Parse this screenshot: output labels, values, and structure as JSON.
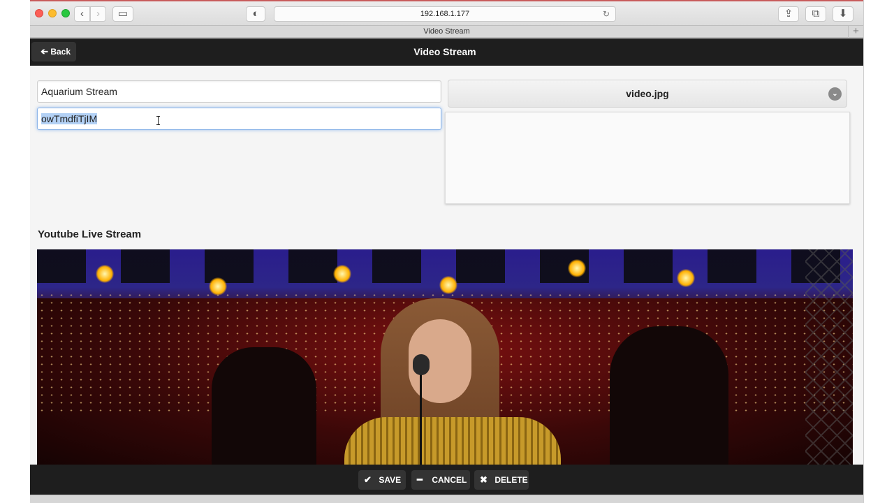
{
  "browser": {
    "url": "192.168.1.177",
    "tab_title": "Video Stream",
    "back_icon": "‹",
    "forward_icon": "›",
    "sidebar_icon": "▭",
    "privacy_icon": "◐",
    "reload_icon": "↻",
    "share_icon": "⇪",
    "tabs_icon": "⧉",
    "download_icon": "⬇",
    "newtab_icon": "+"
  },
  "header": {
    "title": "Video Stream",
    "back_label": "Back",
    "back_icon": "➔"
  },
  "form": {
    "name_value": "Aquarium Stream",
    "id_value": "owTmdfiTjIM",
    "image_select": "video.jpg",
    "select_icon": "⌄"
  },
  "section": {
    "title": "Youtube Live Stream"
  },
  "actions": {
    "save_label": "SAVE",
    "save_icon": "✔",
    "cancel_label": "CANCEL",
    "cancel_icon": "━",
    "delete_label": "DELETE",
    "delete_icon": "✖"
  },
  "colors": {
    "header_bg": "#1e1e1e",
    "focus_ring": "#8db5e8",
    "selection": "#b3d1f5"
  }
}
